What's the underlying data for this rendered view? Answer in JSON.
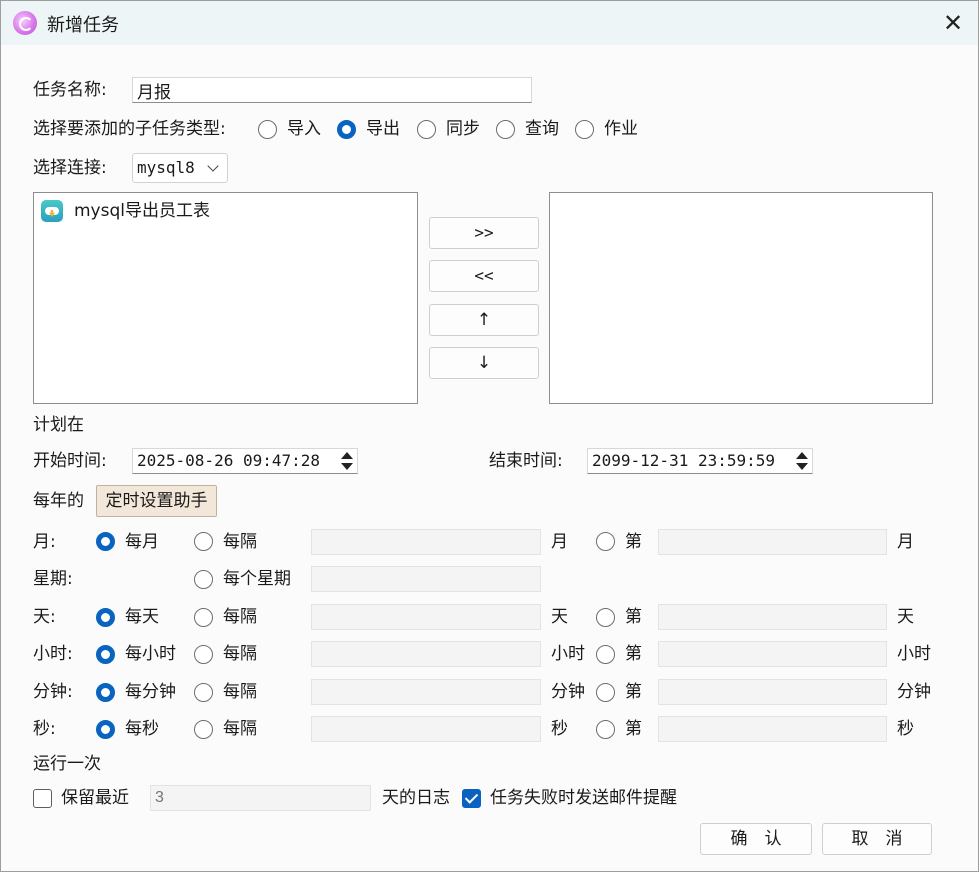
{
  "title": "新增任务",
  "task_name": {
    "label": "任务名称:",
    "value": "月报"
  },
  "subtask_type": {
    "label": "选择要添加的子任务类型:",
    "options": [
      {
        "label": "导入",
        "selected": false
      },
      {
        "label": "导出",
        "selected": true
      },
      {
        "label": "同步",
        "selected": false
      },
      {
        "label": "查询",
        "selected": false
      },
      {
        "label": "作业",
        "selected": false
      }
    ]
  },
  "connection": {
    "label": "选择连接:",
    "value": "mysql8"
  },
  "available_list": [
    "mysql导出员工表"
  ],
  "move_buttons": [
    ">>",
    "<<",
    "↑",
    "↓"
  ],
  "schedule": {
    "label": "计划在",
    "start_label": "开始时间:",
    "start_value": "2025-08-26 09:47:28",
    "end_label": "结束时间:",
    "end_value": "2099-12-31 23:59:59",
    "yearly_label": "每年的",
    "helper_button": "定时设置助手"
  },
  "rows": {
    "month": {
      "label": "月:",
      "every": "每月",
      "interval": "每隔",
      "unit": "月",
      "nth": "第",
      "unit2": "月"
    },
    "week": {
      "label": "星期:",
      "every_week": "每个星期"
    },
    "day": {
      "label": "天:",
      "every": "每天",
      "interval": "每隔",
      "unit": "天",
      "nth": "第",
      "unit2": "天"
    },
    "hour": {
      "label": "小时:",
      "every": "每小时",
      "interval": "每隔",
      "unit": "小时",
      "nth": "第",
      "unit2": "小时"
    },
    "minute": {
      "label": "分钟:",
      "every": "每分钟",
      "interval": "每隔",
      "unit": "分钟",
      "nth": "第",
      "unit2": "分钟"
    },
    "second": {
      "label": "秒:",
      "every": "每秒",
      "interval": "每隔",
      "unit": "秒",
      "nth": "第",
      "unit2": "秒"
    }
  },
  "run_once": "运行一次",
  "retain": {
    "label": "保留最近",
    "placeholder": "3",
    "suffix": "天的日志",
    "checked": false
  },
  "email_on_fail": {
    "label": "任务失败时发送邮件提醒",
    "checked": true
  },
  "footer": {
    "ok": "确　认",
    "cancel": "取　消"
  },
  "colors": {
    "accent": "#0863c1",
    "titlebar": "#edf5f6",
    "helper": "#f3e7da"
  }
}
